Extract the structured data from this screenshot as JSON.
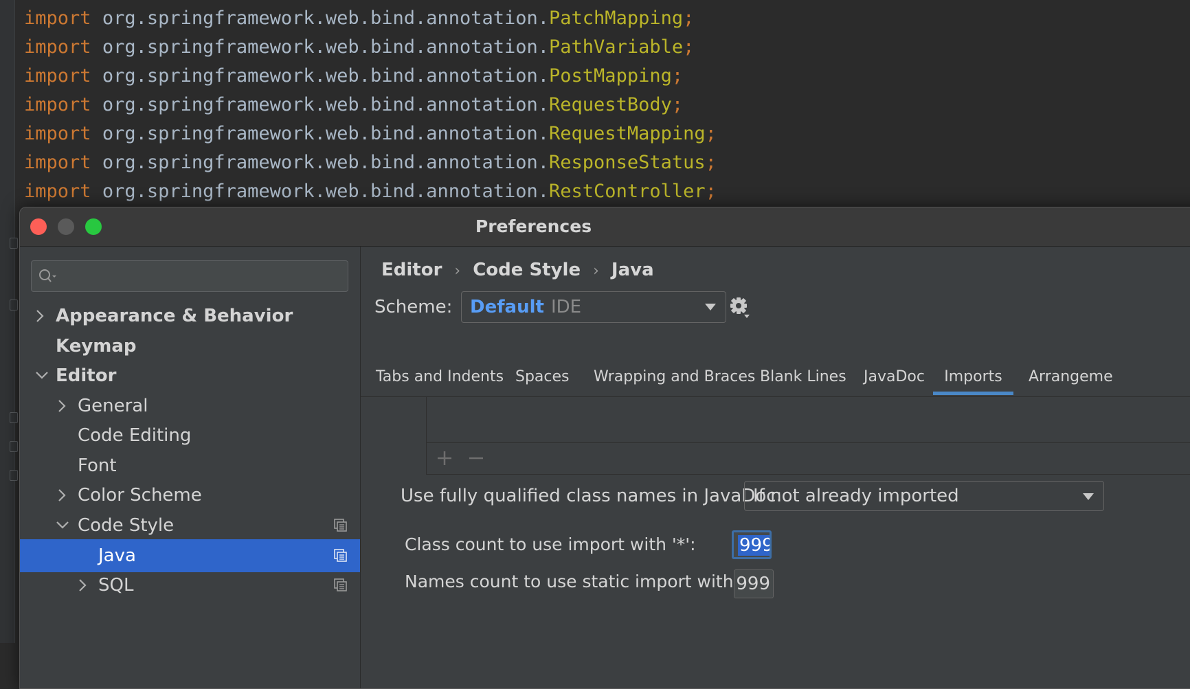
{
  "editor": {
    "lines": [
      {
        "keyword": "import",
        "package": "org.springframework.web.bind.annotation.",
        "class": "PatchMapping",
        "end": ";"
      },
      {
        "keyword": "import",
        "package": "org.springframework.web.bind.annotation.",
        "class": "PathVariable",
        "end": ";"
      },
      {
        "keyword": "import",
        "package": "org.springframework.web.bind.annotation.",
        "class": "PostMapping",
        "end": ";"
      },
      {
        "keyword": "import",
        "package": "org.springframework.web.bind.annotation.",
        "class": "RequestBody",
        "end": ";"
      },
      {
        "keyword": "import",
        "package": "org.springframework.web.bind.annotation.",
        "class": "RequestMapping",
        "end": ";"
      },
      {
        "keyword": "import",
        "package": "org.springframework.web.bind.annotation.",
        "class": "ResponseStatus",
        "end": ";"
      },
      {
        "keyword": "import",
        "package": "org.springframework.web.bind.annotation.",
        "class": "RestController",
        "end": ";"
      }
    ]
  },
  "window": {
    "title": "Preferences"
  },
  "sidebar": {
    "search_placeholder": "",
    "items": [
      {
        "label": "Appearance & Behavior"
      },
      {
        "label": "Keymap"
      },
      {
        "label": "Editor"
      },
      {
        "label": "General"
      },
      {
        "label": "Code Editing"
      },
      {
        "label": "Font"
      },
      {
        "label": "Color Scheme"
      },
      {
        "label": "Code Style"
      },
      {
        "label": "Java"
      },
      {
        "label": "SQL"
      }
    ]
  },
  "main": {
    "breadcrumb": [
      "Editor",
      "Code Style",
      "Java"
    ],
    "breadcrumb_sep": "›",
    "scheme_label": "Scheme:",
    "scheme_value": "Default",
    "scheme_sub": "IDE",
    "tabs": [
      "Tabs and Indents",
      "Spaces",
      "Wrapping and Braces",
      "Blank Lines",
      "JavaDoc",
      "Imports",
      "Arrangeme"
    ],
    "active_tab": "Imports",
    "javadoc_label": "Use fully qualified class names in JavaDoc:",
    "javadoc_value": "If not already imported",
    "class_count_label": "Class count to use import with '*':",
    "class_count_value": "999",
    "names_count_label": "Names count to use static import with '*':",
    "names_count_value": "999"
  },
  "colors": {
    "keyword": "#cc7832",
    "class_name": "#bbb529",
    "selection": "#2f65ca",
    "link_blue": "#589df6",
    "tab_underline": "#4a88c7"
  }
}
